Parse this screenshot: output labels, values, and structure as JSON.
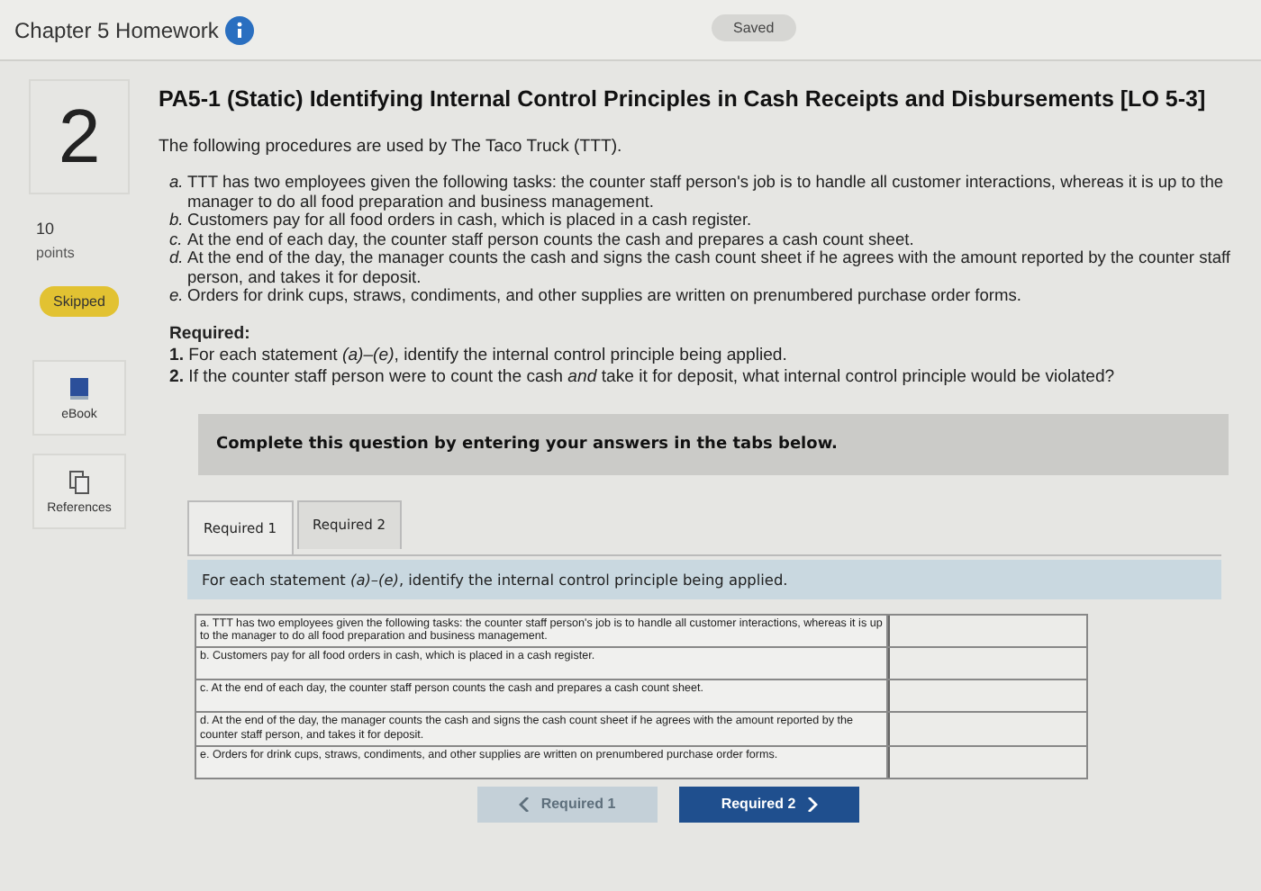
{
  "header": {
    "title": "Chapter 5 Homework",
    "status": "Saved"
  },
  "sidebar": {
    "question_number": "2",
    "points": "10",
    "points_label": "points",
    "status": "Skipped",
    "tools": [
      {
        "kind": "ebook",
        "label": "eBook"
      },
      {
        "kind": "references",
        "label": "References"
      }
    ]
  },
  "question": {
    "title": "PA5-1 (Static) Identifying Internal Control Principles in Cash Receipts and Disbursements [LO 5-3]",
    "intro": "The following procedures are used by The Taco Truck (TTT).",
    "statements": [
      {
        "letter": "a.",
        "text": "TTT has two employees given the following tasks: the counter staff person's job is to handle all customer interactions, whereas it is up to the manager to do all food preparation and business management."
      },
      {
        "letter": "b.",
        "text": "Customers pay for all food orders in cash, which is placed in a cash register."
      },
      {
        "letter": "c.",
        "text": "At the end of each day, the counter staff person counts the cash and prepares a cash count sheet."
      },
      {
        "letter": "d.",
        "text": "At the end of the day, the manager counts the cash and signs the cash count sheet if he agrees with the amount reported by the counter staff person, and takes it for deposit."
      },
      {
        "letter": "e.",
        "text": "Orders for drink cups, straws, condiments, and other supplies are written on prenumbered purchase order forms."
      }
    ],
    "required_heading": "Required:",
    "requirements": [
      "**1.** For each statement *(a)–(e)*, identify the internal control principle being applied.",
      "**2.** If the counter staff person were to count the cash *and* take it for deposit, what internal control principle would be violated?"
    ]
  },
  "answer_area": {
    "instruction": "Complete this question by entering your answers in the tabs below.",
    "tabs": [
      {
        "label": "Required 1",
        "selected": true
      },
      {
        "label": "Required 2",
        "selected": false
      }
    ],
    "prompt": "For each statement *(a)–(e)*, identify the internal control principle being applied.",
    "rows": [
      {
        "statement": "a. TTT has two employees given the following tasks: the counter staff person's job is to handle all customer interactions, whereas it is up to the manager to do all food preparation and business management."
      },
      {
        "statement": "b. Customers pay for all food orders in cash, which is placed in a cash register."
      },
      {
        "statement": "c. At the end of each day, the counter staff person counts the cash and prepares a cash count sheet."
      },
      {
        "statement": "d. At the end of the day, the manager counts the cash and signs the cash count sheet if he agrees with the amount reported by the counter staff person, and takes it for deposit."
      },
      {
        "statement": "e. Orders for drink cups, straws, condiments, and other supplies are written on prenumbered purchase order forms."
      }
    ],
    "nav": [
      {
        "label": "Required 1",
        "kind": "prev",
        "disabled": true
      },
      {
        "label": "Required 2",
        "kind": "next",
        "disabled": false
      }
    ]
  }
}
